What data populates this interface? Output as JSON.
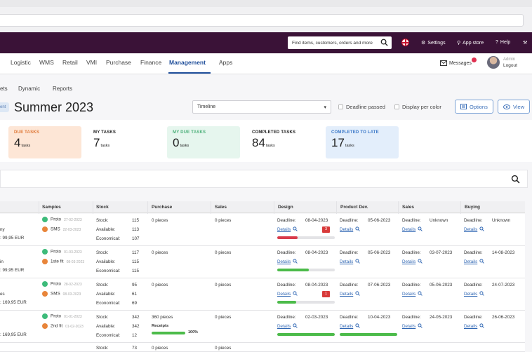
{
  "topbar": {
    "search_placeholder": "Find items, customers, orders and more",
    "settings": "Settings",
    "app_store": "App store",
    "help": "Help"
  },
  "nav": {
    "items": [
      "Logistic",
      "WMS",
      "Retail",
      "VMI",
      "Purchase",
      "Finance",
      "Management",
      "Apps"
    ],
    "active": "Management",
    "messages": "Messages",
    "user_role": "Admin",
    "logout": "Logout"
  },
  "subtabs": [
    "ets",
    "Dynamic",
    "Reports"
  ],
  "page": {
    "title": "Summer 2023",
    "tag_stub": "ent",
    "view_select": "Timeline",
    "deadline_passed": "Deadline passed",
    "display_per_color": "Display per color",
    "options": "Options",
    "view": "View"
  },
  "cards": [
    {
      "label": "DUE TASKS",
      "count": "4",
      "unit": "tasks",
      "bg": "#fde6d6",
      "fg": "#e07a3a"
    },
    {
      "label": "MY TASKS",
      "count": "7",
      "unit": "tasks",
      "bg": "#ffffff",
      "fg": "#222222"
    },
    {
      "label": "MY DUE TASKS",
      "count": "0",
      "unit": "tasks",
      "bg": "#e6f6ee",
      "fg": "#4db07a"
    },
    {
      "label": "COMPLETED TASKS",
      "count": "84",
      "unit": "tasks",
      "bg": "#ffffff",
      "fg": "#222222"
    },
    {
      "label": "COMPLETED TO LATE",
      "count": "17",
      "unit": "tasks",
      "bg": "#e3eefb",
      "fg": "#3b78c8"
    }
  ],
  "table": {
    "headers": [
      "Samples",
      "Stock",
      "Purchase",
      "Sales",
      "Design",
      "Product Dev.",
      "Sales",
      "Buying"
    ],
    "rows": [
      {
        "left": [
          "ny",
          ": 99,95 EUR"
        ],
        "samples": [
          {
            "name": "Proto",
            "date": "27-02-2023",
            "color": "#3dbb7a"
          },
          {
            "name": "SMS",
            "date": "22-03-2023",
            "color": "#e8853a"
          }
        ],
        "stock": {
          "labels": [
            "Stock:",
            "Available:",
            "Economical:"
          ],
          "values": [
            "115",
            "113",
            "107"
          ]
        },
        "purchase": "0 pieces",
        "sales": "0 pieces",
        "design": {
          "deadline": "08-04-2023",
          "badge": "3",
          "progress": 0.35,
          "color": "#d83a4a"
        },
        "product_dev": {
          "deadline": "05-06-2023"
        },
        "sales_col": {
          "deadline": "Unknown"
        },
        "buying": {
          "deadline": "Unknown"
        }
      },
      {
        "left": [
          "in",
          ": 99,95 EUR"
        ],
        "samples": [
          {
            "name": "Proto",
            "date": "01-03-2023",
            "color": "#3dbb7a"
          },
          {
            "name": "1ste fit",
            "date": "08-03-2023",
            "color": "#e8853a"
          }
        ],
        "stock": {
          "labels": [
            "Stock:",
            "Available:",
            "Economical:"
          ],
          "values": [
            "117",
            "115",
            "115"
          ]
        },
        "purchase": "0 pieces",
        "sales": "0 pieces",
        "design": {
          "deadline": "08-04-2023",
          "badge": "",
          "progress": 0.55,
          "color": "#4cbb4a"
        },
        "product_dev": {
          "deadline": "05-06-2023"
        },
        "sales_col": {
          "deadline": "03-07-2023"
        },
        "buying": {
          "deadline": "14-08-2023"
        }
      },
      {
        "left": [
          "es",
          ": 169,95 EUR"
        ],
        "samples": [
          {
            "name": "Proto",
            "date": "28-02-2023",
            "color": "#3dbb7a"
          },
          {
            "name": "SMS",
            "date": "08-03-2023",
            "color": "#e8853a"
          }
        ],
        "stock": {
          "labels": [
            "Stock:",
            "Available:",
            "Economical:"
          ],
          "values": [
            "95",
            "61",
            "69"
          ]
        },
        "purchase": "0 pieces",
        "sales": "0 pieces",
        "design": {
          "deadline": "08-04-2023",
          "badge": "1",
          "progress": 0.33,
          "color": "#4cbb4a"
        },
        "product_dev": {
          "deadline": "07-06-2023"
        },
        "sales_col": {
          "deadline": "05-06-2023"
        },
        "buying": {
          "deadline": "24-07-2023"
        }
      },
      {
        "left": [
          "",
          ": 169,95 EUR"
        ],
        "samples": [
          {
            "name": "Proto",
            "date": "01-01-2023",
            "color": "#3dbb7a"
          },
          {
            "name": "2nd fit",
            "date": "01-02-2023",
            "color": "#e8853a"
          }
        ],
        "stock": {
          "labels": [
            "Stock:",
            "Available:",
            "Economical:"
          ],
          "values": [
            "342",
            "342",
            "12"
          ]
        },
        "purchase": "360 pieces",
        "receipts": "Receipts",
        "receipts_pct": "100%",
        "sales": "0 pieces",
        "design": {
          "deadline": "02-03-2023",
          "badge": "",
          "progress": 1.0,
          "color": "#4cbb4a"
        },
        "product_dev": {
          "deadline": "10-04-2023",
          "progress": 1.0
        },
        "sales_col": {
          "deadline": "24-05-2023"
        },
        "buying": {
          "deadline": "26-06-2023"
        }
      }
    ],
    "partial_row": {
      "stock_label": "Stock:",
      "stock_value": "73",
      "purchase": "0 pieces",
      "sales": "0 pieces"
    },
    "deadline_label": "Deadline:",
    "details_label": "Details"
  }
}
